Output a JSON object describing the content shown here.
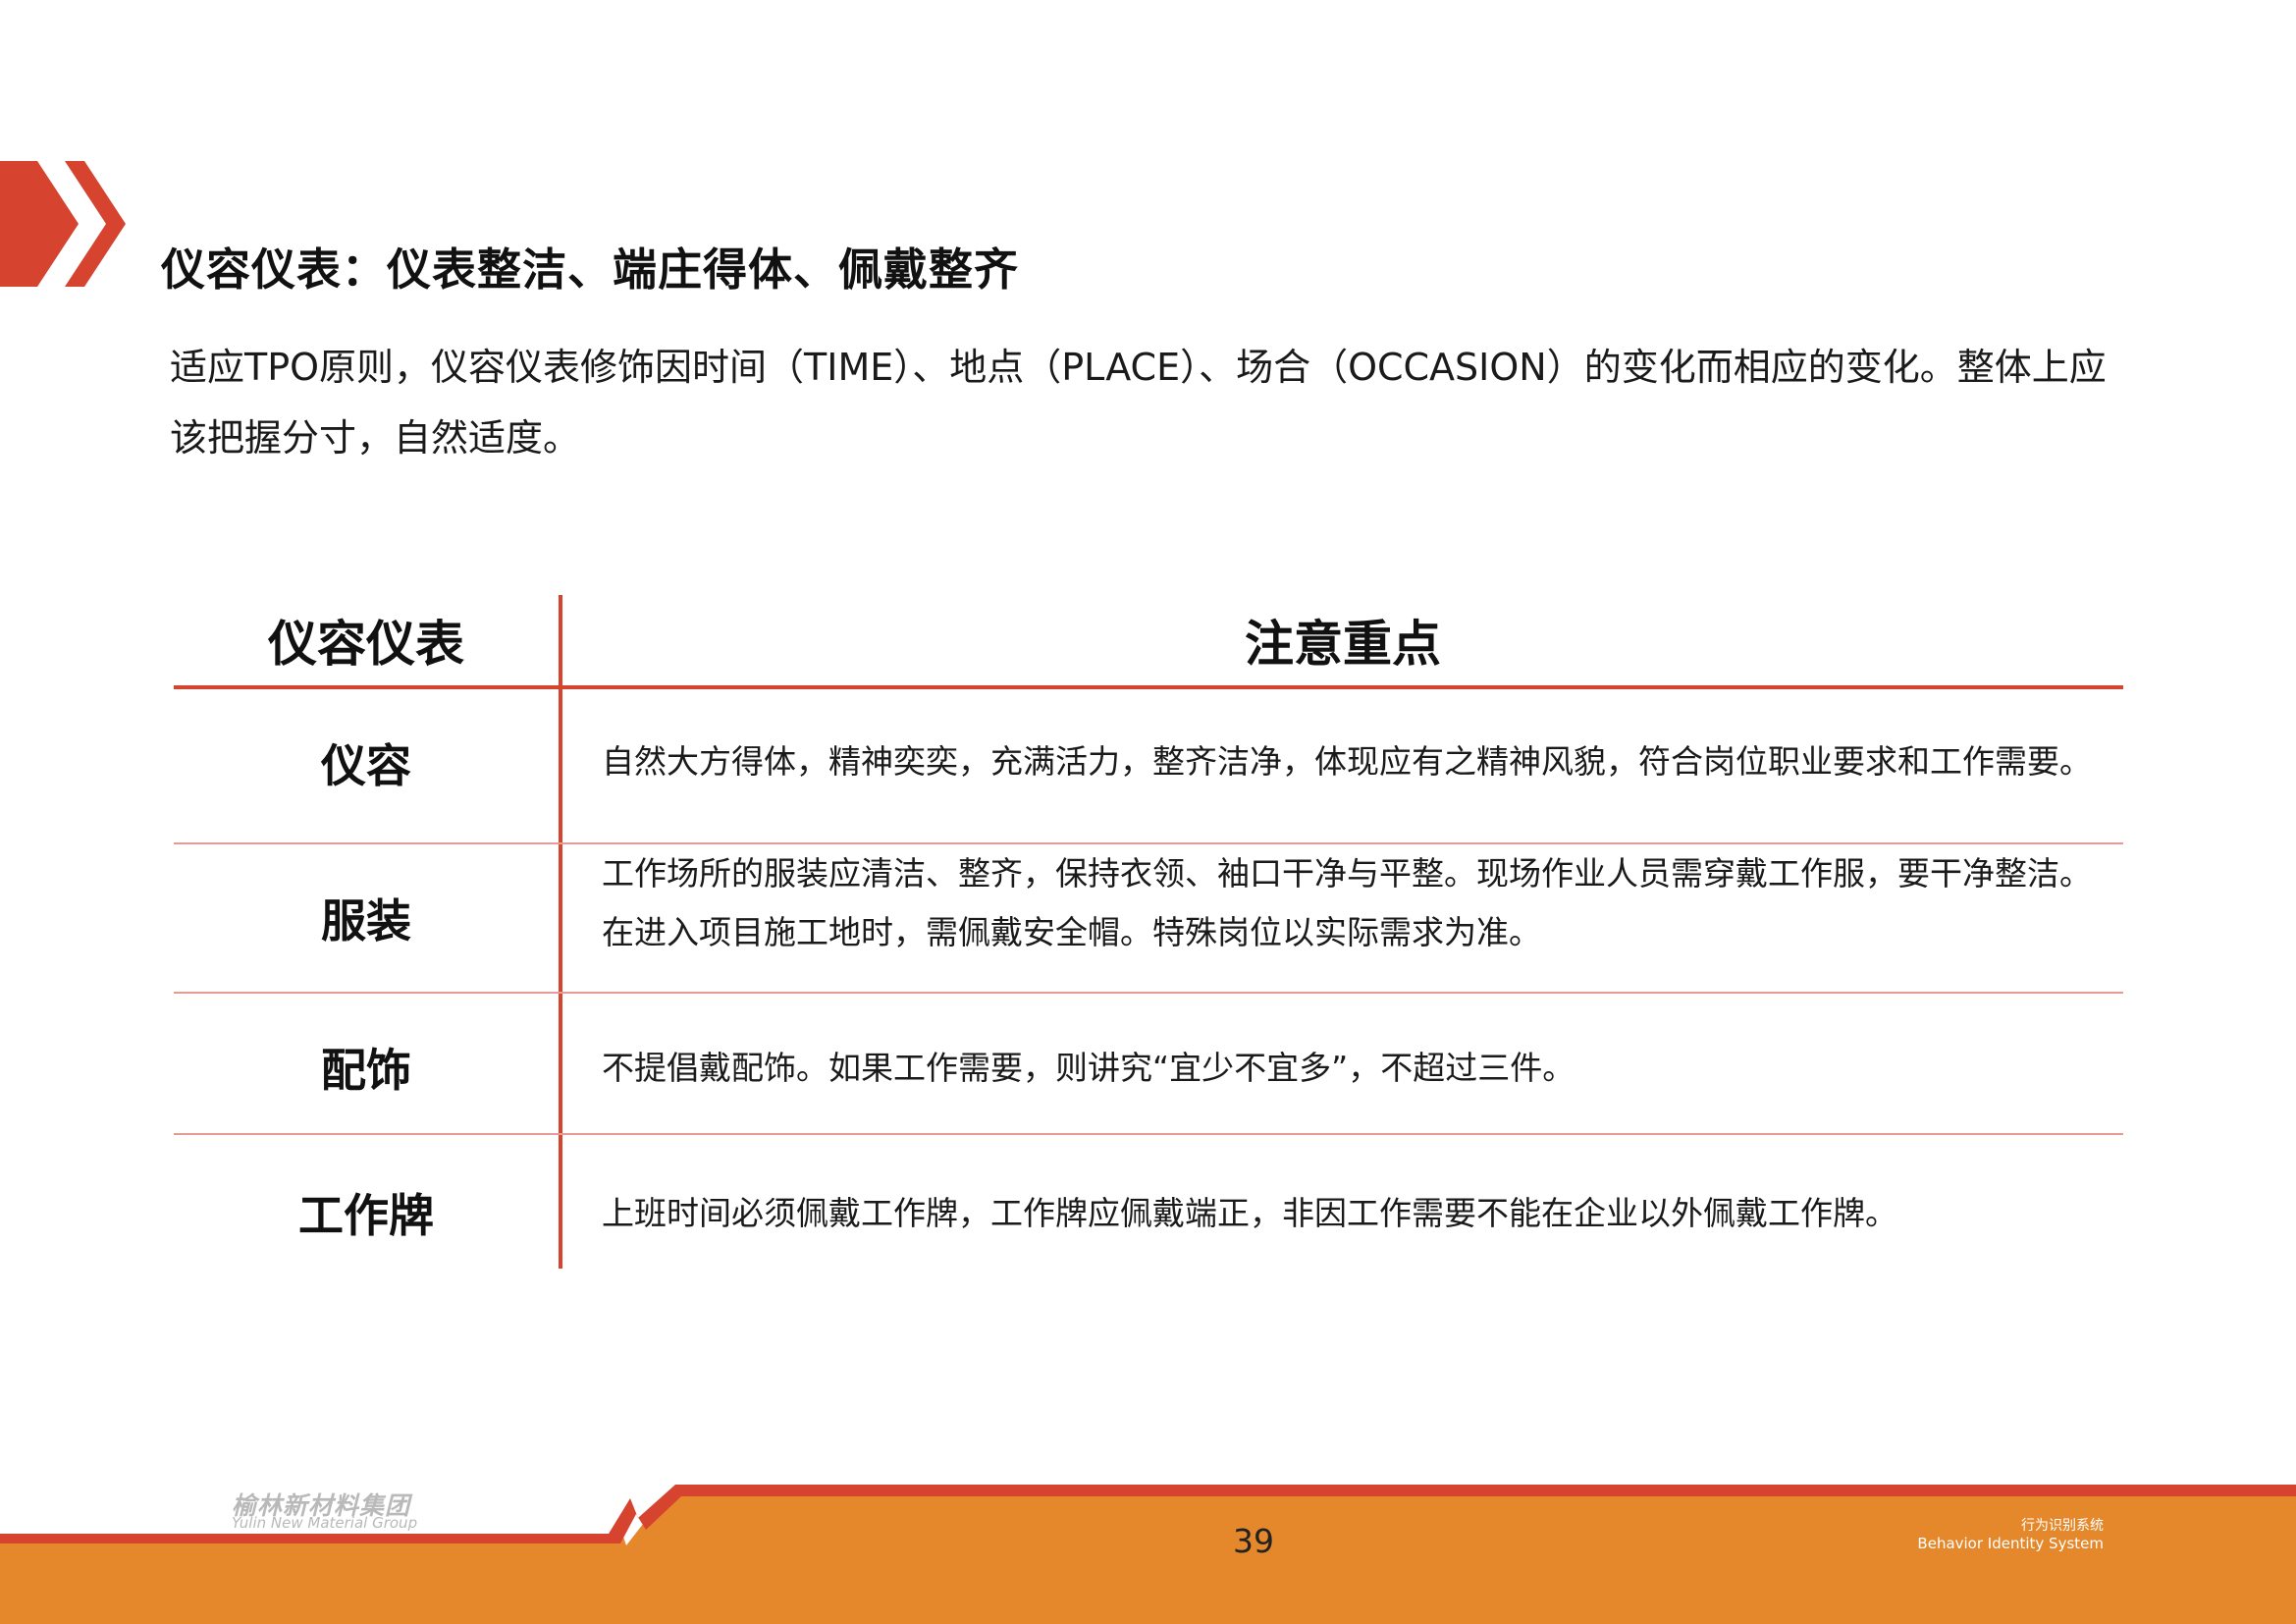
{
  "title": "仪容仪表：仪表整洁、端庄得体、佩戴整齐",
  "intro": "适应TPO原则，仪容仪表修饰因时间（TIME）、地点（PLACE）、场合（OCCASION）的变化而相应的变化。整体上应该把握分寸，自然适度。",
  "table": {
    "headers": [
      "仪容仪表",
      "注意重点"
    ],
    "rows": [
      {
        "label": "仪容",
        "lines": [
          "自然大方得体，精神奕奕，充满活力，整齐洁净，体现应有之精神风貌，符合岗位职业要求和工作需要。"
        ]
      },
      {
        "label": "服装",
        "lines": [
          "工作场所的服装应清洁、整齐，保持衣领、袖口干净与平整。现场作业人员需穿戴工作服，要干净整洁。",
          "在进入项目施工地时，需佩戴安全帽。特殊岗位以实际需求为准。"
        ]
      },
      {
        "label": "配饰",
        "lines": [
          "不提倡戴配饰。如果工作需要，则讲究“宜少不宜多”，不超过三件。"
        ]
      },
      {
        "label": "工作牌",
        "lines": [
          "上班时间必须佩戴工作牌，工作牌应佩戴端正，非因工作需要不能在企业以外佩戴工作牌。"
        ]
      }
    ]
  },
  "footer": {
    "logo_cn": "榆林新材料集团",
    "logo_en": "Yulin New Material Group",
    "page_number": "39",
    "system_cn": "行为识别系统",
    "system_en": "Behavior Identity System"
  },
  "colors": {
    "accent_red": "#d6432f",
    "footer_orange": "#e5882c",
    "row_divider": "#e69a93"
  },
  "icons": [
    "double-chevron-icon"
  ]
}
